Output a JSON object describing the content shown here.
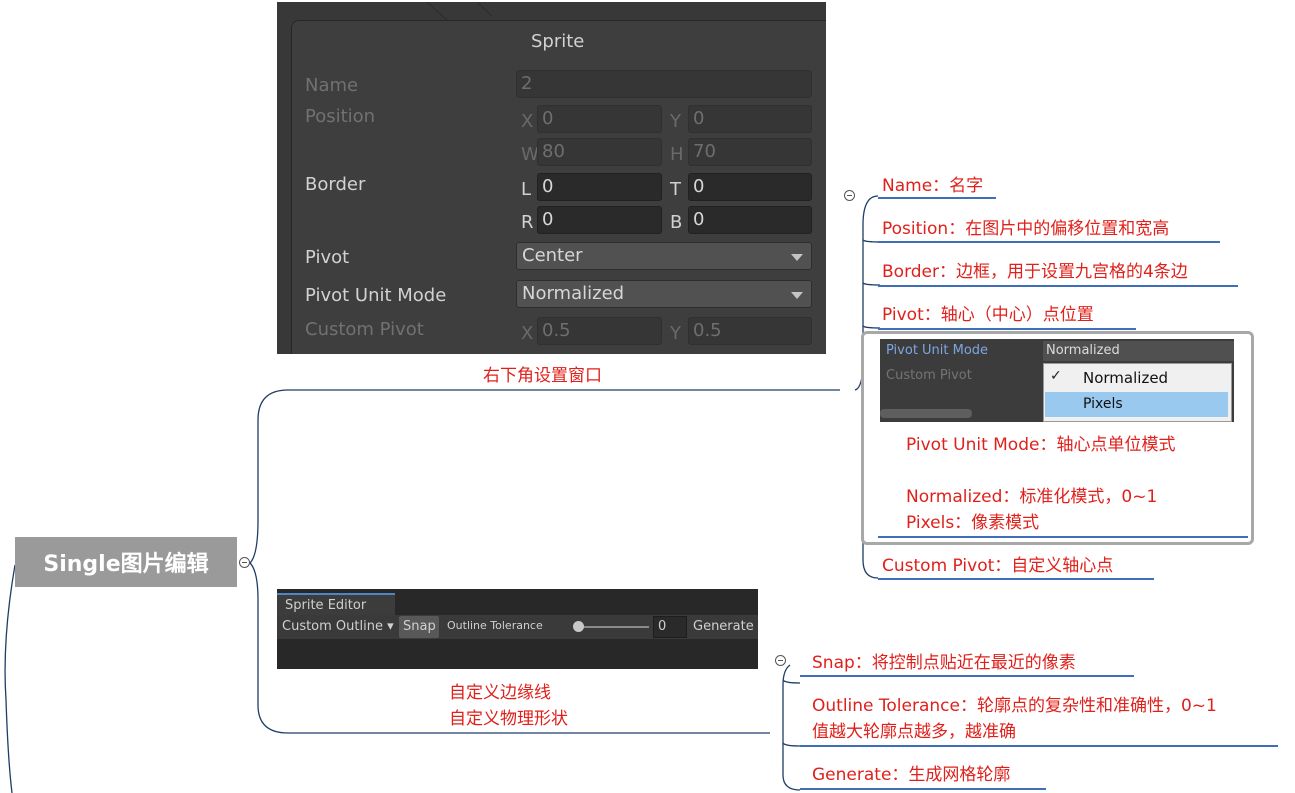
{
  "root": {
    "label": "Single图片编辑"
  },
  "branch_top": {
    "caption": "右下角设置窗口"
  },
  "branch_bottom": {
    "caption_line1": "自定义边缘线",
    "caption_line2": "自定义物理形状"
  },
  "inspector": {
    "title": "Sprite",
    "name_label": "Name",
    "name_value": "2",
    "position_label": "Position",
    "x_axis": "X",
    "x_value": "0",
    "y_axis": "Y",
    "y_value": "0",
    "w_axis": "W",
    "w_value": "80",
    "h_axis": "H",
    "h_value": "70",
    "border_label": "Border",
    "l_axis": "L",
    "l_value": "0",
    "t_axis": "T",
    "t_value": "0",
    "r_axis": "R",
    "r_value": "0",
    "b_axis": "B",
    "b_value": "0",
    "pivot_label": "Pivot",
    "pivot_value": "Center",
    "pivot_unit_label": "Pivot Unit Mode",
    "pivot_unit_value": "Normalized",
    "custom_pivot_label": "Custom Pivot",
    "cp_x_axis": "X",
    "cp_x_value": "0.5",
    "cp_y_axis": "Y",
    "cp_y_value": "0.5"
  },
  "sprite_editor": {
    "tab": "Sprite Editor",
    "mode_dropdown": "Custom Outline",
    "snap_button": "Snap",
    "tolerance_label": "Outline Tolerance",
    "tolerance_value": "0",
    "generate_button": "Generate"
  },
  "popup": {
    "pivot_unit_label": "Pivot Unit Mode",
    "selected_value": "Normalized",
    "custom_pivot_label": "Custom Pivot",
    "options": [
      "Normalized",
      "Pixels"
    ],
    "checkmark": "✓",
    "desc1": "Pivot Unit Mode：轴心点单位模式",
    "desc2": "Normalized：标准化模式，0~1",
    "desc3": "Pixels：像素模式"
  },
  "notes_top": [
    "Name：名字",
    "Position：在图片中的偏移位置和宽高",
    "Border：边框，用于设置九宫格的4条边",
    "Pivot：轴心（中心）点位置",
    "Custom Pivot：自定义轴心点"
  ],
  "notes_bottom": [
    "Snap：将控制点贴近在最近的像素",
    "Outline Tolerance：轮廓点的复杂性和准确性，0~1",
    "值越大轮廓点越多，越准确",
    "Generate：生成网格轮廓"
  ],
  "colors": {
    "note_text": "#e0201b",
    "connector": "#1f3d66",
    "underline": "#3f6fb8",
    "root_fill": "#9a9a9a"
  }
}
